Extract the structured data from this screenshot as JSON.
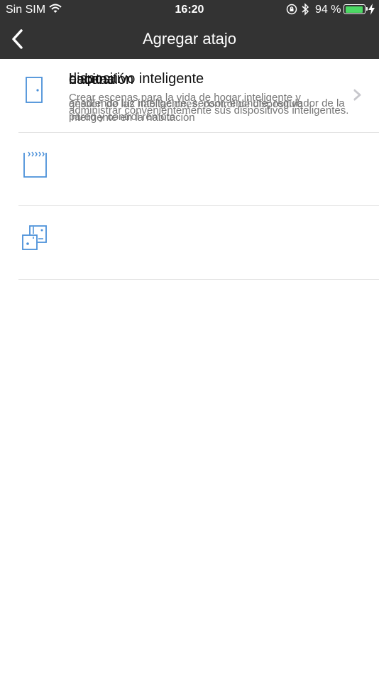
{
  "status_bar": {
    "carrier": "Sin SIM",
    "time": "16:20",
    "battery_percent": "94 %",
    "battery_level": 0.94,
    "battery_color": "#4cd964",
    "icons": [
      "wifi-icon",
      "rotation-lock-icon",
      "bluetooth-icon",
      "battery-icon",
      "charging-bolt-icon"
    ]
  },
  "nav": {
    "title": "Agregar atajo",
    "back_icon": "chevron-left-icon",
    "background": "#333333"
  },
  "items": [
    {
      "title": "habitación",
      "description": "gestión de las habitaciones, control de dispositivo inteligente en la habitación",
      "icon": "door-icon"
    },
    {
      "title": "escena",
      "description": "Crear escenas para la vida de hogar inteligente y administrar convenientemente sus dispositivos inteligentes.",
      "icon": "scene-icon"
    },
    {
      "title": "dispositivo inteligente",
      "description": "añadiendo luz inteligente, sensor, enchufe, regulador de la pared y control remoto",
      "icon": "smart-device-icon"
    }
  ],
  "accent_color": "#4a90d9"
}
